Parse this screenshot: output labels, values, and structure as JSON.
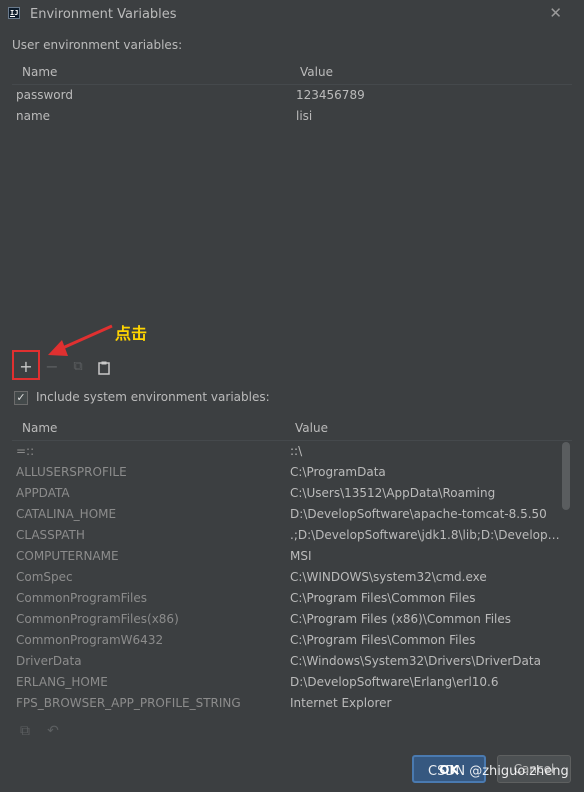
{
  "window": {
    "title": "Environment Variables",
    "app_icon": "intellij-icon",
    "close_glyph": "✕"
  },
  "user_section": {
    "label": "User environment variables:",
    "columns": {
      "name": "Name",
      "value": "Value"
    },
    "rows": [
      {
        "name": "password",
        "value": "123456789"
      },
      {
        "name": "name",
        "value": "lisi"
      }
    ]
  },
  "toolbar": {
    "add": "+",
    "remove": "−",
    "copy": "⧉",
    "paste": "📋"
  },
  "annotation": {
    "text": "点击",
    "color": "#ffd400",
    "arrow_color": "#e03030"
  },
  "system_section": {
    "include_label": "Include system environment variables:",
    "include_checked": true,
    "check_glyph": "✓",
    "columns": {
      "name": "Name",
      "value": "Value"
    },
    "rows": [
      {
        "name": "=::",
        "value": "::\\"
      },
      {
        "name": "ALLUSERSPROFILE",
        "value": "C:\\ProgramData"
      },
      {
        "name": "APPDATA",
        "value": "C:\\Users\\13512\\AppData\\Roaming"
      },
      {
        "name": "CATALINA_HOME",
        "value": "D:\\DevelopSoftware\\apache-tomcat-8.5.50"
      },
      {
        "name": "CLASSPATH",
        "value": ".;D:\\DevelopSoftware\\jdk1.8\\lib;D:\\DevelopS..."
      },
      {
        "name": "COMPUTERNAME",
        "value": "MSI"
      },
      {
        "name": "ComSpec",
        "value": "C:\\WINDOWS\\system32\\cmd.exe"
      },
      {
        "name": "CommonProgramFiles",
        "value": "C:\\Program Files\\Common Files"
      },
      {
        "name": "CommonProgramFiles(x86)",
        "value": "C:\\Program Files (x86)\\Common Files"
      },
      {
        "name": "CommonProgramW6432",
        "value": "C:\\Program Files\\Common Files"
      },
      {
        "name": "DriverData",
        "value": "C:\\Windows\\System32\\Drivers\\DriverData"
      },
      {
        "name": "ERLANG_HOME",
        "value": "D:\\DevelopSoftware\\Erlang\\erl10.6"
      },
      {
        "name": "FPS_BROWSER_APP_PROFILE_STRING",
        "value": "Internet Explorer"
      }
    ]
  },
  "bottom_tools": {
    "copy": "⧉",
    "undo": "↶"
  },
  "buttons": {
    "ok": "OK",
    "cancel": "Cancel"
  },
  "watermark": "CSDN @zhiguo.zheng",
  "colors": {
    "background": "#3c3f41",
    "text": "#bbbbbb",
    "accent": "#365880"
  }
}
